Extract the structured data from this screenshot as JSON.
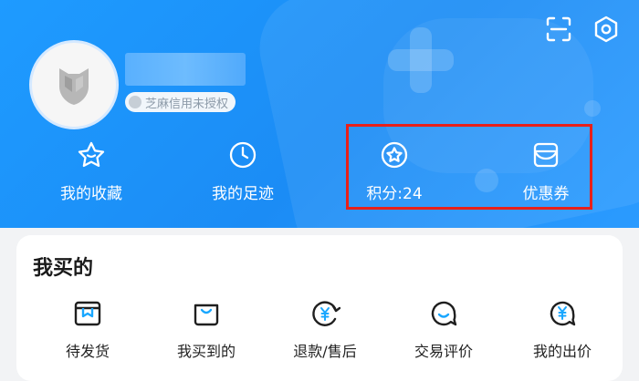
{
  "profile": {
    "zhima_label": "芝麻信用未授权"
  },
  "stats": [
    {
      "label": "我的收藏",
      "icon": "star-icon"
    },
    {
      "label": "我的足迹",
      "icon": "clock-icon"
    },
    {
      "label": "积分:24",
      "icon": "points-icon"
    },
    {
      "label": "优惠券",
      "icon": "coupon-icon"
    }
  ],
  "orders": {
    "title": "我买的",
    "items": [
      {
        "label": "待发货",
        "icon": "package-box-icon"
      },
      {
        "label": "我买到的",
        "icon": "shopping-bag-icon"
      },
      {
        "label": "退款/售后",
        "icon": "yen-refund-icon"
      },
      {
        "label": "交易评价",
        "icon": "chat-bubble-icon"
      },
      {
        "label": "我的出价",
        "icon": "yen-bid-icon"
      }
    ]
  },
  "colors": {
    "header_blue": "#1e9bff",
    "highlight_red": "#e8201a",
    "icon_dark": "#1f1f1f",
    "icon_accent": "#19a7ff"
  }
}
